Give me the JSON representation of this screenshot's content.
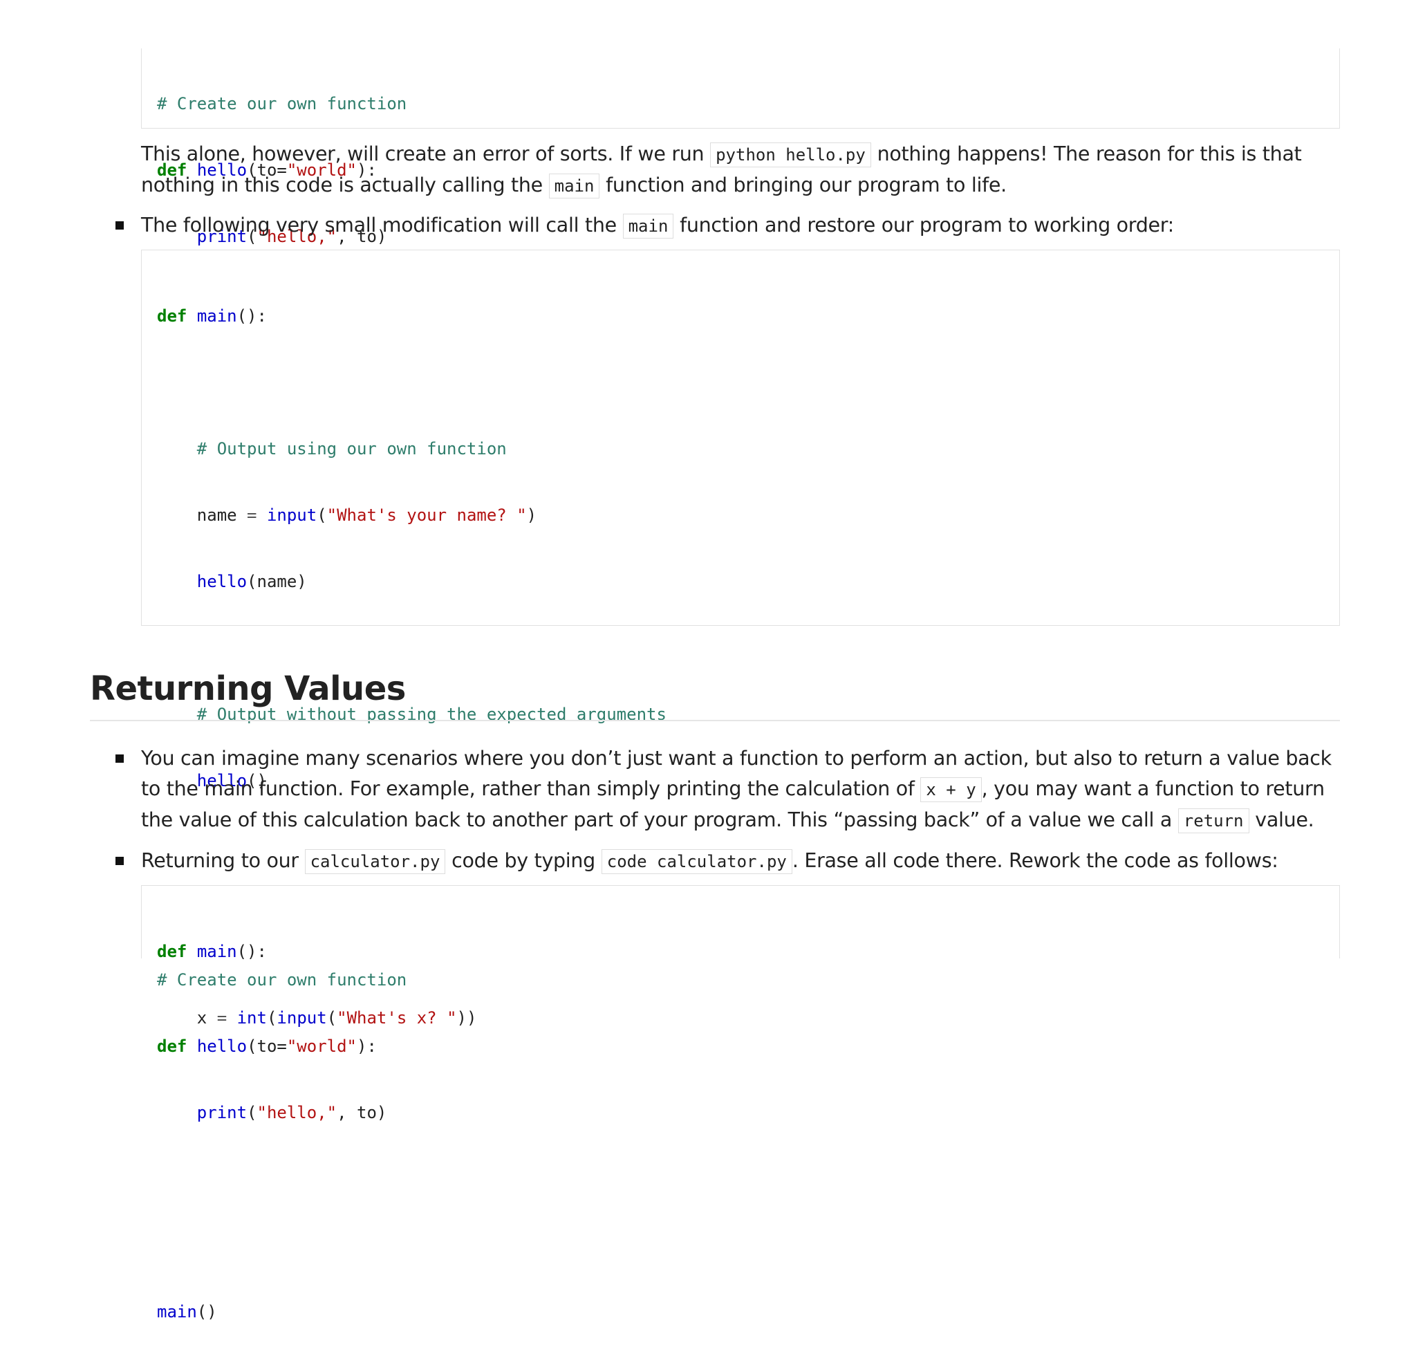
{
  "block1": {
    "comment": "# Create our own function",
    "def_kw": "def",
    "def_name": "hello",
    "def_param": "(to=",
    "def_default": "\"world\"",
    "def_end": "):",
    "print_fn": "print",
    "print_open": "(",
    "print_str": "\"hello,\"",
    "print_rest": ", to)"
  },
  "para1": {
    "t1": "This alone, however, will create an error of sorts. If we run ",
    "c1": "python hello.py",
    "t2": " nothing happens! The reason for this is that nothing in this code is actually calling the ",
    "c2": "main",
    "t3": " function and bringing our program to life."
  },
  "bullet1": {
    "t1": "The following very small modification will call the ",
    "c1": "main",
    "t2": " function and restore our program to working order:"
  },
  "block2": {
    "def_kw": "def",
    "main_name": "main",
    "main_end": "():",
    "comment1": "# Output using our own function",
    "name_var": "name",
    "eq": " = ",
    "input_fn": "input",
    "open": "(",
    "input_str": "\"What's your name? \"",
    "close": ")",
    "hello_fn": "hello",
    "hello_args": "(name)",
    "comment2": "# Output without passing the expected arguments",
    "hello_empty": "()",
    "comment3": "# Create our own function",
    "def_name": "hello",
    "def_param": "(to=",
    "def_default": "\"world\"",
    "def_end": "):",
    "print_fn": "print",
    "print_str": "\"hello,\"",
    "print_rest": ", to)",
    "main_call": "main",
    "main_call_args": "()"
  },
  "heading": "Returning Values",
  "bullet2": {
    "t1": "You can imagine many scenarios where you don’t just want a function to perform an action, but also to return a value back to the main function. For example, rather than simply printing the calculation of ",
    "c1": "x + y",
    "t2": ", you may want a function to return the value of this calculation back to another part of your program. This “passing back” of a value we call a ",
    "c2": "return",
    "t3": " value."
  },
  "bullet3": {
    "t1": "Returning to our ",
    "c1": "calculator.py",
    "t2": " code by typing ",
    "c2": "code calculator.py",
    "t3": ". Erase all code there. Rework the code as follows:"
  },
  "block3": {
    "def_kw": "def",
    "main_name": "main",
    "main_end": "():",
    "x_var": "x",
    "eq": " = ",
    "int_fn": "int",
    "open": "(",
    "input_fn": "input",
    "input_str": "\"What's x? \"",
    "close": "))"
  }
}
